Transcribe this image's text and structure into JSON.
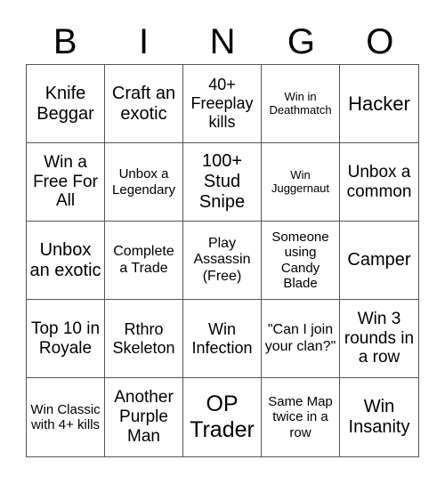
{
  "header": {
    "letters": [
      "B",
      "I",
      "N",
      "G",
      "O"
    ]
  },
  "cells": [
    "Knife Beggar",
    "Craft an exotic",
    "40+ Freeplay kills",
    "Win in Deathmatch",
    "Hacker",
    "Win a Free For All",
    "Unbox a Legendary",
    "100+ Stud Snipe",
    "Win Juggernaut",
    "Unbox a common",
    "Unbox an exotic",
    "Complete a Trade",
    "Play Assassin (Free)",
    "Someone using Candy Blade",
    "Camper",
    "Top 10 in Royale",
    "Rthro Skeleton",
    "Win Infection",
    "\"Can I join your clan?\"",
    "Win 3 rounds in a row",
    "Win Classic with 4+ kills",
    "Another Purple Man",
    "OP Trader",
    "Same Map twice in a row",
    "Win Insanity"
  ]
}
